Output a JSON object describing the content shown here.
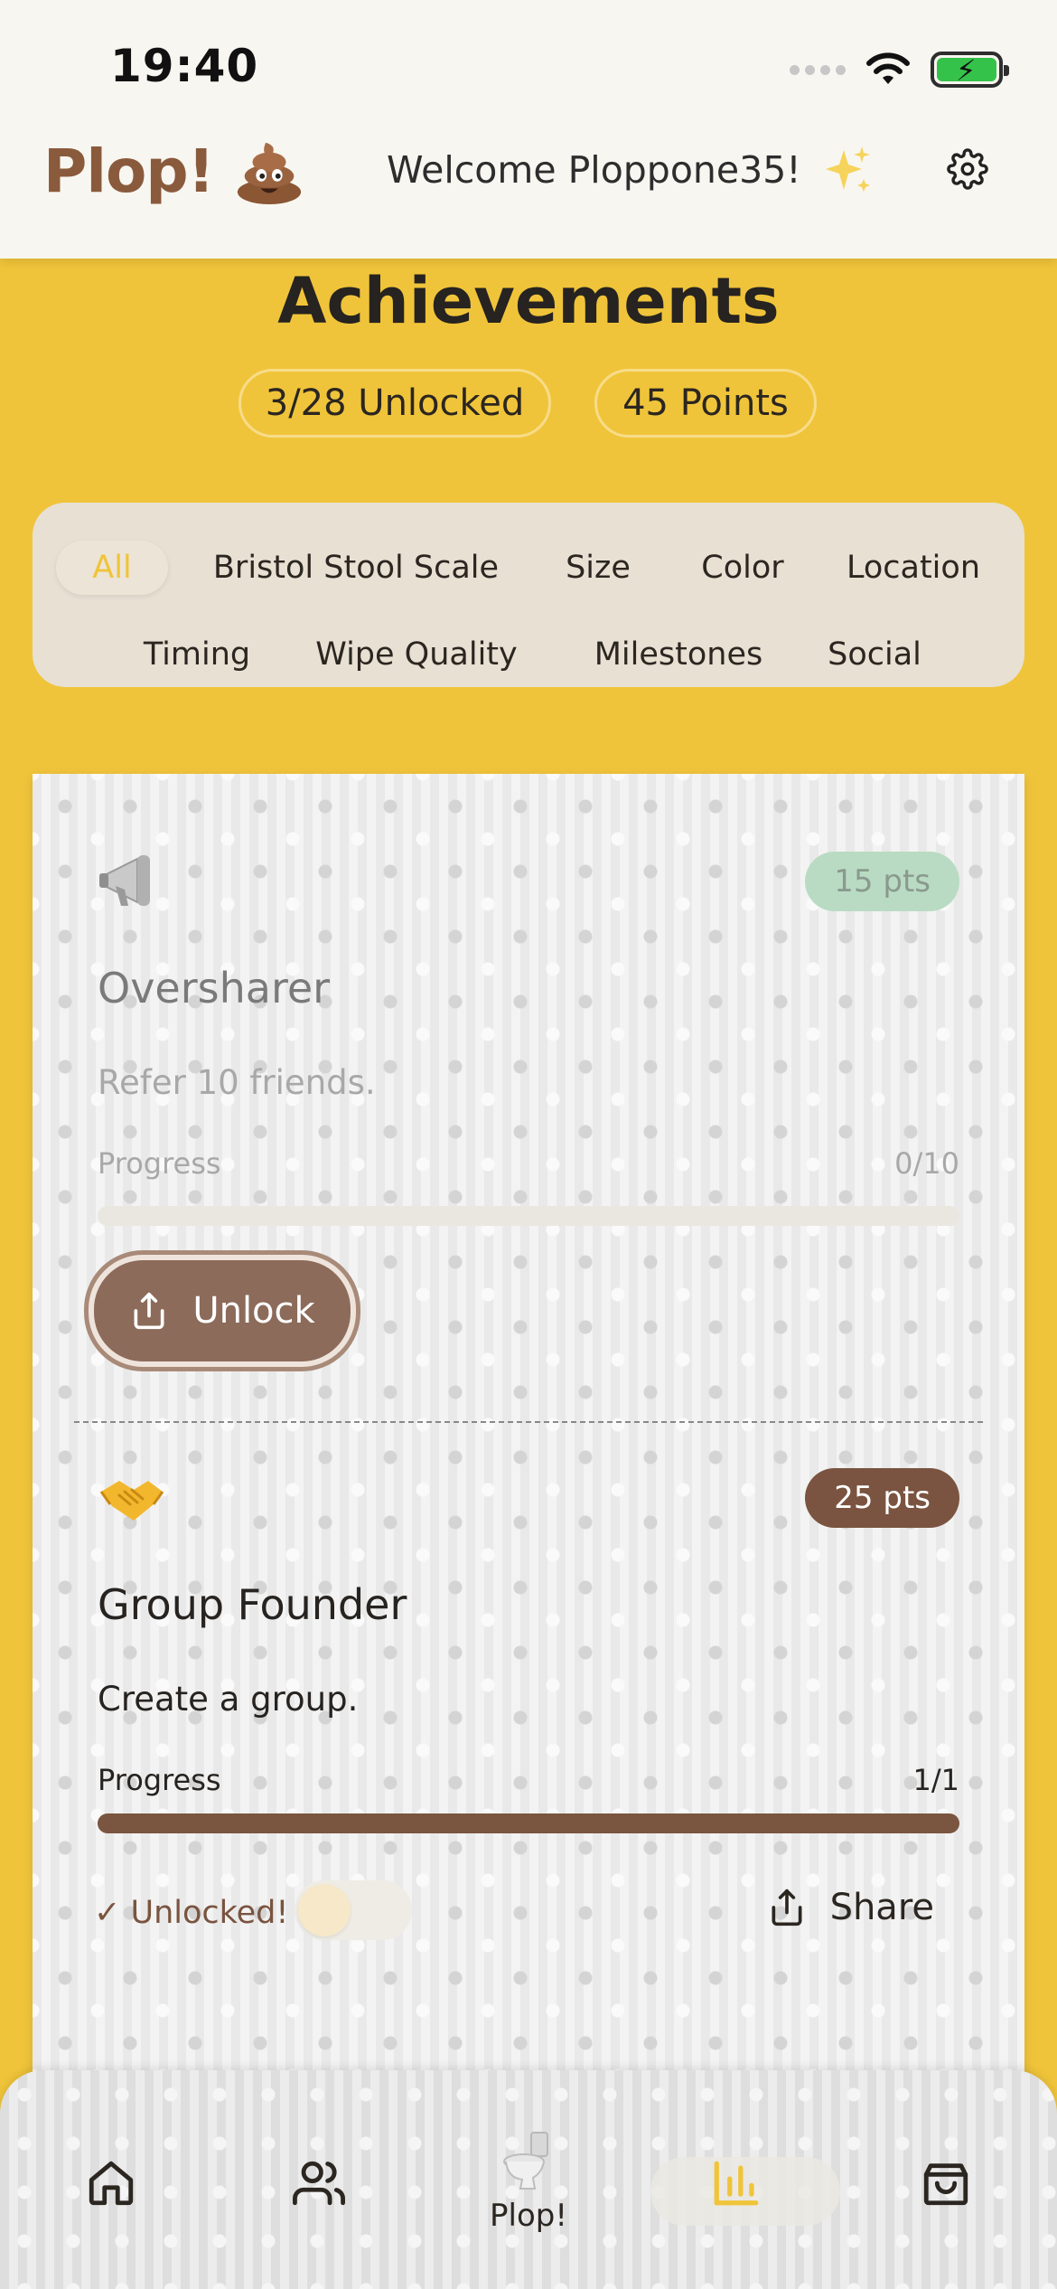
{
  "status_bar": {
    "time": "19:40",
    "icons": [
      "signal-dots-icon",
      "wifi-icon",
      "battery-charging-icon"
    ],
    "battery_color": "#35c24a"
  },
  "header": {
    "brand": "Plop!",
    "brand_icon": "poop-icon",
    "welcome": "Welcome Ploppone35!",
    "sparkle_icon": "sparkles-icon",
    "settings_icon": "gear-icon"
  },
  "page": {
    "title": "Achievements",
    "unlocked_pill": "3/28 Unlocked",
    "points_pill": "45 Points"
  },
  "filters": {
    "active": "All",
    "items": [
      "All",
      "Bristol Stool Scale",
      "Size",
      "Color",
      "Location",
      "Timing",
      "Wipe Quality",
      "Milestones",
      "Social"
    ]
  },
  "achievements": [
    {
      "icon": "megaphone-icon",
      "points": "15 pts",
      "name": "Oversharer",
      "description": "Refer 10 friends.",
      "progress_label": "Progress",
      "progress_value": "0/10",
      "progress_fraction": 0,
      "state": "locked",
      "action_label": "Unlock",
      "action_icon": "share-icon"
    },
    {
      "icon": "handshake-icon",
      "points": "25 pts",
      "name": "Group Founder",
      "description": "Create a group.",
      "progress_label": "Progress",
      "progress_value": "1/1",
      "progress_fraction": 1,
      "state": "unlocked",
      "unlocked_label": "✓ Unlocked!",
      "share_label": "Share",
      "share_icon": "share-icon"
    }
  ],
  "tabbar": {
    "items": [
      {
        "icon": "home-icon",
        "label": ""
      },
      {
        "icon": "friends-icon",
        "label": ""
      },
      {
        "icon": "toilet-icon",
        "label": "Plop!"
      },
      {
        "icon": "bar-chart-icon",
        "label": "",
        "active": true
      },
      {
        "icon": "shopping-bag-icon",
        "label": ""
      }
    ],
    "active_color": "#f0c43a"
  },
  "colors": {
    "background": "#f0c43a",
    "brand_brown": "#8a5a3c",
    "points_locked": "#b9dbc3",
    "points_unlocked": "#7a5440"
  }
}
